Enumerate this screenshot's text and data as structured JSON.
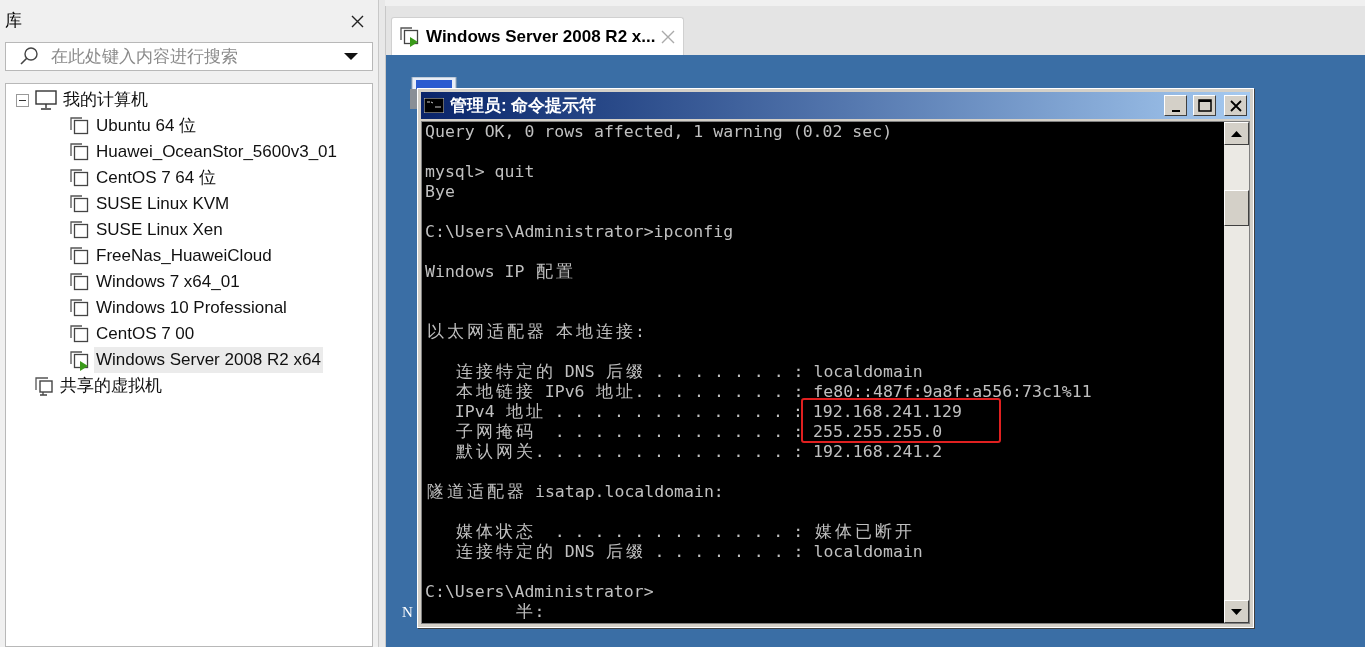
{
  "library": {
    "title": "库",
    "search": {
      "placeholder": "在此处键入内容进行搜索"
    },
    "tree": [
      {
        "label": "我的计算机",
        "kind": "computer",
        "expanded": true,
        "children": [
          {
            "label": "Ubuntu 64 位",
            "running": false,
            "selected": false
          },
          {
            "label": "Huawei_OceanStor_5600v3_01",
            "running": false,
            "selected": false
          },
          {
            "label": "CentOS 7 64 位",
            "running": false,
            "selected": false
          },
          {
            "label": "SUSE Linux KVM",
            "running": false,
            "selected": false
          },
          {
            "label": "SUSE Linux Xen",
            "running": false,
            "selected": false
          },
          {
            "label": "FreeNas_HuaweiCloud",
            "running": false,
            "selected": false
          },
          {
            "label": "Windows 7 x64_01",
            "running": false,
            "selected": false
          },
          {
            "label": "Windows 10 Professional",
            "running": false,
            "selected": false
          },
          {
            "label": "CentOS 7 00",
            "running": false,
            "selected": false
          },
          {
            "label": "Windows Server 2008 R2 x64",
            "running": true,
            "selected": true
          }
        ]
      },
      {
        "label": "共享的虚拟机",
        "kind": "shared"
      }
    ]
  },
  "tabs": [
    {
      "label": "Windows Server 2008 R2 x...",
      "running": true,
      "selected": true
    }
  ],
  "desktop": {
    "icon_label": "N"
  },
  "console": {
    "title": "管理员: 命令提示符",
    "blocks": [
      {
        "lines": [
          "Query OK, 0 rows affected, 1 warning (0.02 sec)"
        ]
      },
      {
        "lines": [
          "mysql> quit",
          "Bye"
        ]
      },
      {
        "lines": [
          "C:\\Users\\Administrator>ipconfig"
        ]
      },
      {
        "lines": [
          "Windows IP 配置"
        ]
      },
      {
        "extra_blank": true,
        "lines": [
          "以太网适配器 本地连接:"
        ]
      },
      {
        "lines": [
          "   连接特定的 DNS 后缀 . . . . . . . : localdomain",
          "   本地链接 IPv6 地址. . . . . . . . : fe80::487f:9a8f:a556:73c1%11",
          "   IPv4 地址 . . . . . . . . . . . . : 192.168.241.129",
          "   子网掩码  . . . . . . . . . . . . : 255.255.255.0",
          "   默认网关. . . . . . . . . . . . . : 192.168.241.2"
        ]
      },
      {
        "lines": [
          "隧道适配器 isatap.localdomain:"
        ]
      },
      {
        "lines": [
          "   媒体状态  . . . . . . . . . . . . : 媒体已断开",
          "   连接特定的 DNS 后缀 . . . . . . . : localdomain"
        ]
      },
      {
        "lines": [
          "C:\\Users\\Administrator>",
          "         半:"
        ]
      }
    ]
  }
}
